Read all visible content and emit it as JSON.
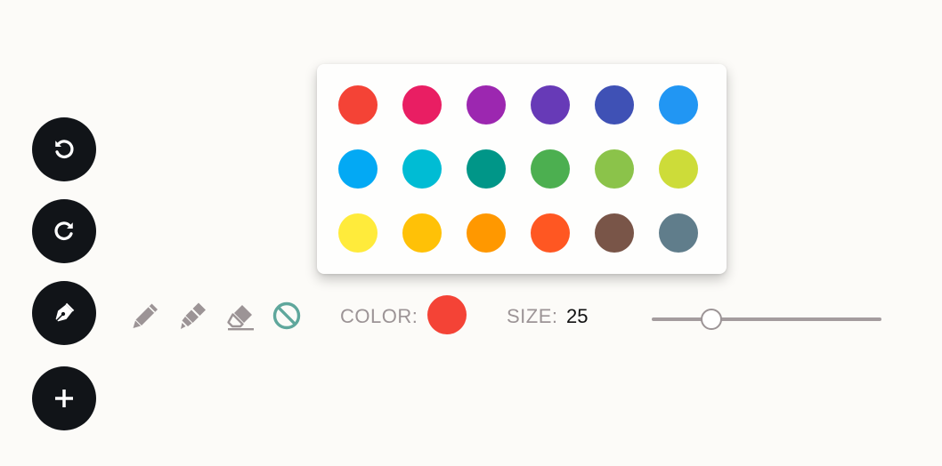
{
  "fabs": [
    {
      "name": "undo-button",
      "icon": "undo-icon"
    },
    {
      "name": "redo-button",
      "icon": "redo-icon"
    },
    {
      "name": "pen-button",
      "icon": "fountain-pen-icon"
    },
    {
      "name": "add-button",
      "icon": "plus-icon"
    }
  ],
  "palette": {
    "colors": [
      "#f44336",
      "#e91e63",
      "#9c27b0",
      "#673ab7",
      "#3f51b5",
      "#2196f3",
      "#03a9f4",
      "#00bcd4",
      "#009688",
      "#4caf50",
      "#8bc34a",
      "#cddc39",
      "#ffeb3b",
      "#ffc107",
      "#ff9800",
      "#ff5722",
      "#795548",
      "#607d8b"
    ]
  },
  "toolbar": {
    "tools": [
      {
        "name": "pencil-tool",
        "icon": "pencil-icon"
      },
      {
        "name": "marker-tool",
        "icon": "highlighter-icon"
      },
      {
        "name": "eraser-tool",
        "icon": "eraser-icon"
      },
      {
        "name": "none-tool",
        "icon": "prohibited-icon",
        "active_color": "#5fa79c"
      }
    ],
    "color_label": "COLOR:",
    "selected_color": "#f44336",
    "size_label": "SIZE:",
    "size_value": "25",
    "size_slider_fraction": 0.26,
    "icon_color": "#9c9496"
  }
}
